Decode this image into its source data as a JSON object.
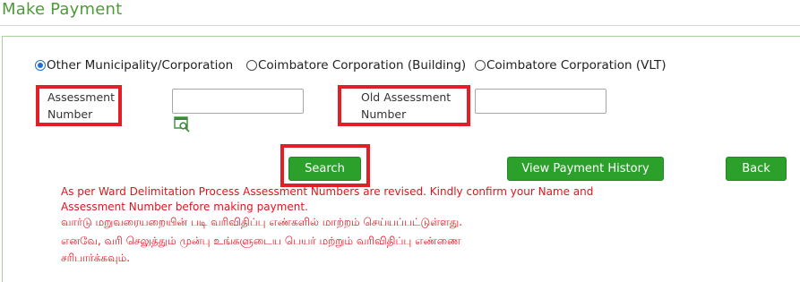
{
  "page": {
    "title": "Make Payment"
  },
  "radios": [
    {
      "label": "Other Municipality/Corporation",
      "checked": true
    },
    {
      "label": "Coimbatore Corporation (Building)",
      "checked": false
    },
    {
      "label": "Coimbatore Corporation (VLT)",
      "checked": false
    }
  ],
  "fields": {
    "assessment": {
      "label_line1": "Assessment",
      "label_line2": "Number",
      "value": "",
      "lookup_icon": "search-record-icon"
    },
    "old_assessment": {
      "label_line1": "Old Assessment",
      "label_line2": "Number",
      "value": ""
    }
  },
  "buttons": {
    "search": "Search",
    "history": "View Payment History",
    "back": "Back"
  },
  "notice": {
    "en_line1": "As per Ward Delimitation Process Assessment Numbers are revised. Kindly confirm your Name and",
    "en_line2": "Assessment Number before making payment.",
    "ta_line1": "வார்டு மறுவரையறையின் படி வரிவிதிப்பு எண்களில் மாற்றம் செய்யப்பட்டுள்ளது.",
    "ta_line2": "எனவே, வரி செலுத்தும் முன்பு உங்களுடைய பெயர் மற்றும் வரிவிதிப்பு எண்ணை",
    "ta_line3": "சரிபார்க்கவும்."
  },
  "colors": {
    "accent": "#2ba02b",
    "highlight": "#e41e26",
    "notice": "#e0141e"
  }
}
